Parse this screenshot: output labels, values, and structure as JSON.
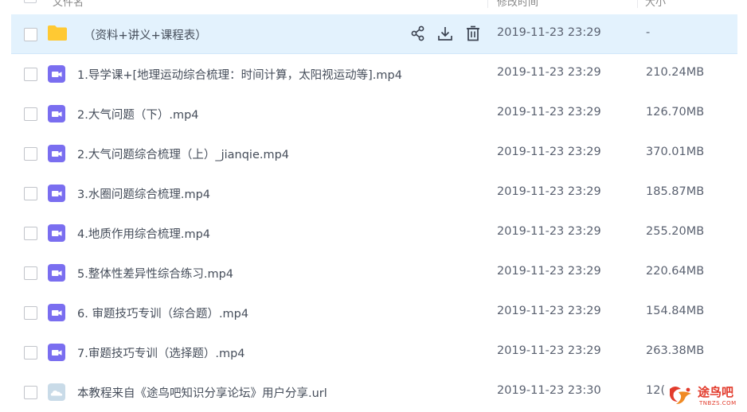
{
  "header": {
    "name_label": "文件名",
    "date_label": "修改时间",
    "size_label": "大小"
  },
  "files": [
    {
      "icon": "folder-icon",
      "name": "（资料+讲义+课程表）",
      "date": "2019-11-23 23:29",
      "size": "-",
      "selected": true
    },
    {
      "icon": "video-icon",
      "name": "1.导学课+[地理运动综合梳理：时间计算，太阳视运动等].mp4",
      "date": "2019-11-23 23:29",
      "size": "210.24MB"
    },
    {
      "icon": "video-icon",
      "name": "2.大气问题（下）.mp4",
      "date": "2019-11-23 23:29",
      "size": "126.70MB"
    },
    {
      "icon": "video-icon",
      "name": "2.大气问题综合梳理（上）_jianqie.mp4",
      "date": "2019-11-23 23:29",
      "size": "370.01MB"
    },
    {
      "icon": "video-icon",
      "name": "3.水圈问题综合梳理.mp4",
      "date": "2019-11-23 23:29",
      "size": "185.87MB"
    },
    {
      "icon": "video-icon",
      "name": "4.地质作用综合梳理.mp4",
      "date": "2019-11-23 23:29",
      "size": "255.20MB"
    },
    {
      "icon": "video-icon",
      "name": "5.整体性差异性综合练习.mp4",
      "date": "2019-11-23 23:29",
      "size": "220.64MB"
    },
    {
      "icon": "video-icon",
      "name": "6. 审题技巧专训（综合题）.mp4",
      "date": "2019-11-23 23:29",
      "size": "154.84MB"
    },
    {
      "icon": "video-icon",
      "name": "7.审题技巧专训（选择题）.mp4",
      "date": "2019-11-23 23:29",
      "size": "263.38MB"
    },
    {
      "icon": "link-icon",
      "name": "本教程来自《途鸟吧知识分享论坛》用户分享.url",
      "date": "2019-11-23 23:30",
      "size": "12("
    }
  ],
  "row_actions": [
    "share-icon",
    "download-icon",
    "delete-icon"
  ],
  "watermark": {
    "text": "途鸟吧",
    "sub": "TNBZS.COM"
  },
  "colors": {
    "selected_row": "#e3f2fd",
    "folder": "#ffc933",
    "video": "#7a6ef0",
    "link": "#c9dbe8",
    "accent": "#3d8ff0"
  }
}
